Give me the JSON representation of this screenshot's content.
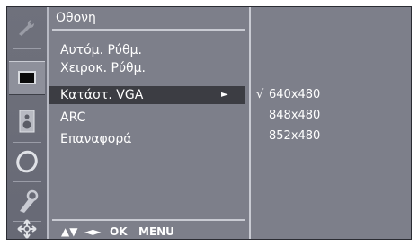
{
  "sidebar": {
    "icons": [
      "wrench-icon",
      "picture-icon",
      "speaker-icon",
      "clock-icon",
      "key-icon",
      "input-icon"
    ],
    "active_index": 1
  },
  "menu": {
    "title": "Οθονη",
    "items": [
      {
        "label": "Αυτόμ. Ρύθμ."
      },
      {
        "label": "Χειροκ. Ρύθμ."
      },
      {
        "label": "Κατάστ. VGA",
        "arrow": "►"
      },
      {
        "label": "ARC"
      },
      {
        "label": "Επαναφορά"
      }
    ],
    "selected_index": 2,
    "footer": {
      "updown": "▲▼",
      "leftright": "◄►",
      "ok": "OK",
      "menu": "MENU"
    }
  },
  "submenu": {
    "check": "√",
    "options": [
      "640x480",
      "848x480",
      "852x480"
    ],
    "checked_index": 0
  },
  "colors": {
    "panel": "#7d7f8a",
    "highlight": "#3c3d43",
    "text": "#ffffff"
  }
}
